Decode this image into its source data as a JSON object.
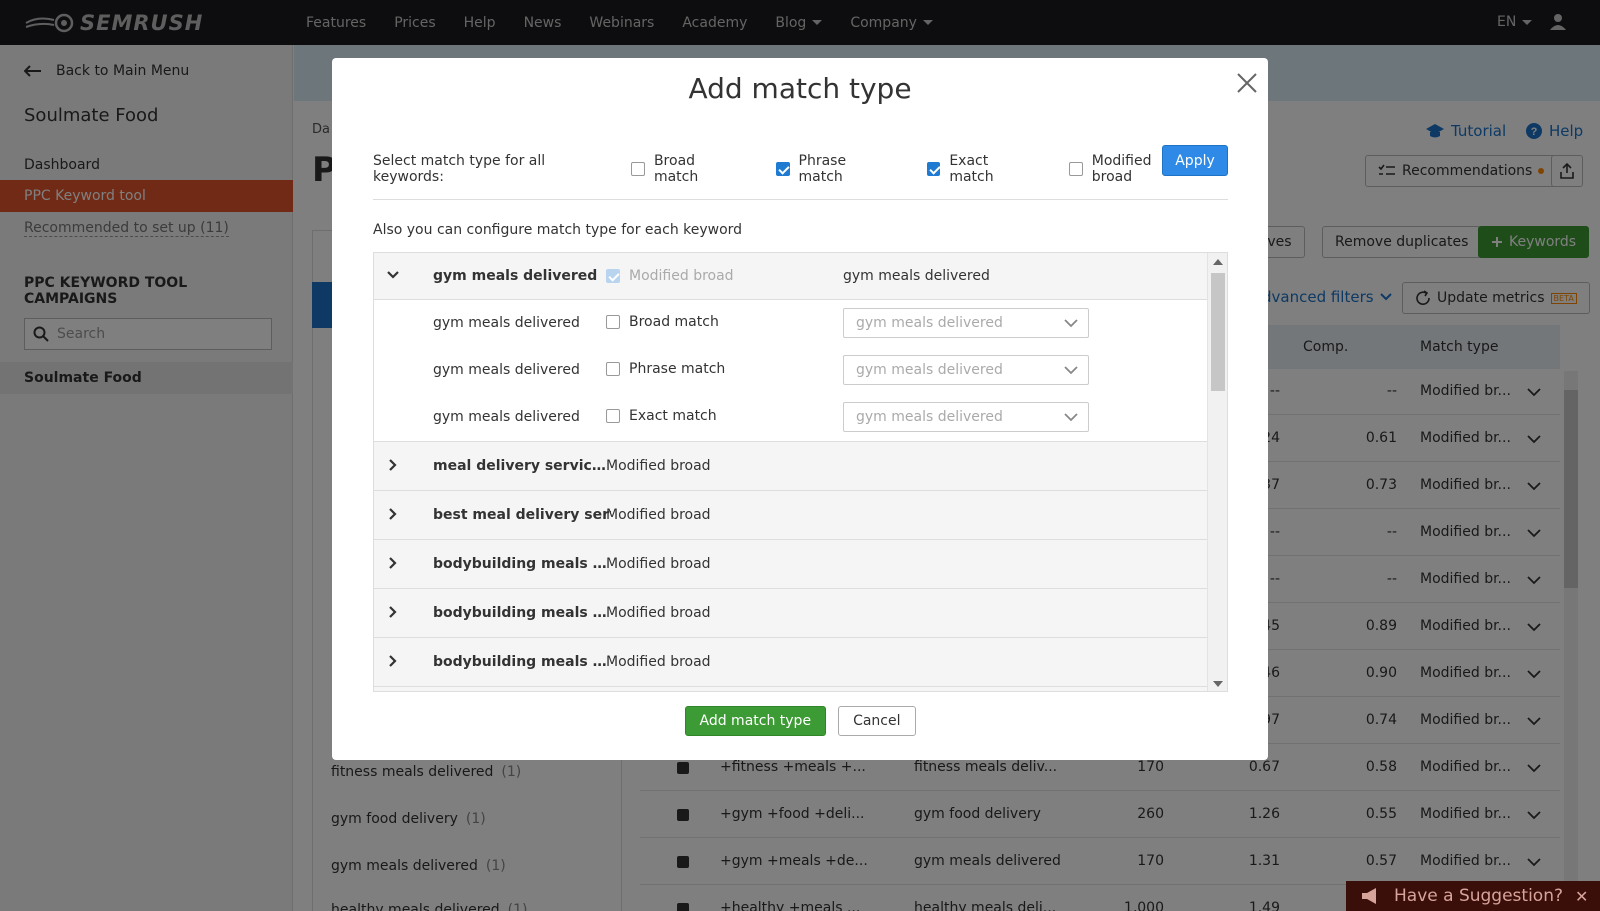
{
  "nav": {
    "brand": "SEMRUSH",
    "links": [
      "Features",
      "Prices",
      "Help",
      "News",
      "Webinars",
      "Academy",
      "Blog",
      "Company"
    ],
    "lang": "EN"
  },
  "sidebar": {
    "back_label": "Back to Main Menu",
    "project": "Soulmate Food",
    "items": [
      {
        "label": "Dashboard"
      },
      {
        "label": "PPC Keyword tool"
      },
      {
        "label": "Recommended to set up (11)"
      }
    ],
    "campaigns_heading": "PPC KEYWORD TOOL CAMPAIGNS",
    "search_placeholder": "Search",
    "campaign": "Soulmate Food"
  },
  "main": {
    "title_fragment": "P",
    "breadcrumb_fragment": "Da",
    "tutorial": "Tutorial",
    "help": "Help",
    "recommendations": "Recommendations",
    "negatives_fragment": "tives",
    "remove_duplicates": "Remove duplicates",
    "keywords_btn": "Keywords",
    "advanced_filters": "dvanced filters",
    "update_metrics": "Update metrics",
    "beta": "BETA",
    "columns": {
      "comp": "Comp.",
      "match_type": "Match type"
    },
    "rows": [
      {
        "cpc": "--",
        "comp": "--",
        "match": "Modified br..."
      },
      {
        "cpc": "24",
        "comp": "0.61",
        "match": "Modified br..."
      },
      {
        "cpc": "37",
        "comp": "0.73",
        "match": "Modified br..."
      },
      {
        "cpc": "--",
        "comp": "--",
        "match": "Modified br..."
      },
      {
        "cpc": "--",
        "comp": "--",
        "match": "Modified br..."
      },
      {
        "cpc": "45",
        "comp": "0.89",
        "match": "Modified br..."
      },
      {
        "cpc": "46",
        "comp": "0.90",
        "match": "Modified br..."
      },
      {
        "cpc": "97",
        "comp": "0.74",
        "match": "Modified br..."
      },
      {
        "kw": "+fitness +meals +...",
        "target": "fitness meals deliv...",
        "vol": "170",
        "cpc": "0.67",
        "comp": "0.58",
        "match": "Modified br..."
      },
      {
        "kw": "+gym +food +deli...",
        "target": "gym food delivery",
        "vol": "260",
        "cpc": "1.26",
        "comp": "0.55",
        "match": "Modified br..."
      },
      {
        "kw": "+gym +meals +de...",
        "target": "gym meals delivered",
        "vol": "170",
        "cpc": "1.31",
        "comp": "0.57",
        "match": "Modified br..."
      },
      {
        "kw": "+healthy +meals ...",
        "target": "healthy meals deli...",
        "vol": "1,000",
        "cpc": "1.49",
        "comp": "",
        "match": ""
      }
    ],
    "left_keywords": [
      {
        "label": "fitness meals delivered",
        "count": "(1)"
      },
      {
        "label": "gym food delivery",
        "count": "(1)"
      },
      {
        "label": "gym meals delivered",
        "count": "(1)"
      },
      {
        "label": "healthy meals delivered",
        "count": "(1)"
      }
    ]
  },
  "modal": {
    "title": "Add match type",
    "select_label": "Select match type for all keywords:",
    "options": [
      {
        "label": "Broad match",
        "checked": false
      },
      {
        "label": "Phrase match",
        "checked": true
      },
      {
        "label": "Exact match",
        "checked": true
      },
      {
        "label": "Modified broad",
        "checked": false
      }
    ],
    "apply": "Apply",
    "also_text": "Also you can configure match type for each keyword",
    "expanded_group": {
      "keyword": "gym meals delivered",
      "match": "Modified broad",
      "target": "gym meals delivered",
      "subrows": [
        {
          "keyword": "gym meals delivered",
          "match": "Broad match",
          "target": "gym meals delivered"
        },
        {
          "keyword": "gym meals delivered",
          "match": "Phrase match",
          "target": "gym meals delivered"
        },
        {
          "keyword": "gym meals delivered",
          "match": "Exact match",
          "target": "gym meals delivered"
        }
      ]
    },
    "groups": [
      {
        "keyword": "meal delivery services",
        "match": "Modified broad"
      },
      {
        "keyword": "best meal delivery service",
        "match": "Modified broad"
      },
      {
        "keyword": "bodybuilding meals deli...",
        "match": "Modified broad"
      },
      {
        "keyword": "bodybuilding meals deli...",
        "match": "Modified broad"
      },
      {
        "keyword": "bodybuilding meals deli...",
        "match": "Modified broad"
      }
    ],
    "add_button": "Add match type",
    "cancel_button": "Cancel"
  },
  "suggestion": "Have a Suggestion?"
}
